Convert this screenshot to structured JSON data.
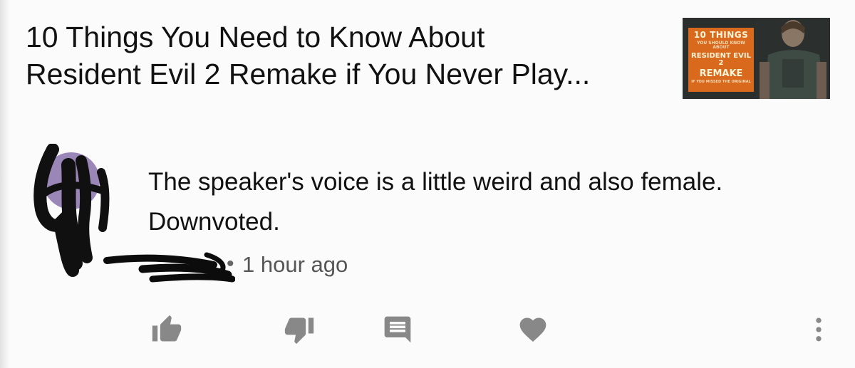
{
  "video": {
    "title": "10 Things You Need to Know About\nResident Evil 2 Remake if You Never Play...",
    "thumbnail": {
      "line1": "10 THINGS",
      "line2": "YOU SHOULD KNOW ABOUT",
      "line3": "RESIDENT EVIL 2",
      "line4": "REMAKE",
      "line5": "IF YOU MISSED THE ORIGINAL"
    }
  },
  "comment": {
    "text": "The speaker's voice is a little weird and also female. Downvoted.",
    "separator": "•",
    "timestamp": "1 hour ago"
  },
  "actions": {
    "icons": [
      "thumbs-up-icon",
      "thumbs-down-icon",
      "comment-icon",
      "heart-icon",
      "more-vertical-icon"
    ]
  },
  "colors": {
    "icon": "#888888",
    "text": "#111111",
    "meta": "#555555",
    "thumbnail_accent": "#d9691c"
  }
}
